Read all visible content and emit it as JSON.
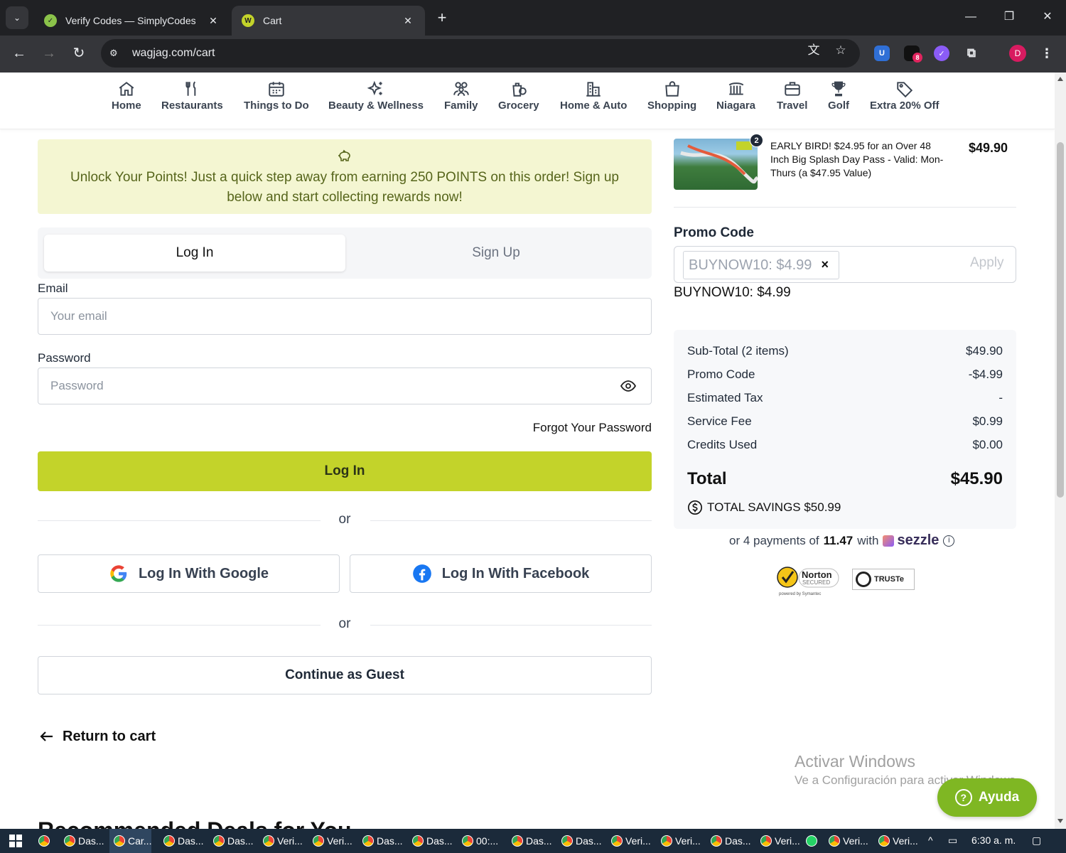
{
  "browser": {
    "tabs": [
      {
        "title": "Verify Codes — SimplyCodes",
        "active": false
      },
      {
        "title": "Cart",
        "active": true
      }
    ],
    "url": "wagjag.com/cart",
    "profile_initial": "D",
    "extension_badge": "8"
  },
  "categories": [
    {
      "label": "Home",
      "icon": "home-icon"
    },
    {
      "label": "Restaurants",
      "icon": "fork-knife-icon"
    },
    {
      "label": "Things to Do",
      "icon": "calendar-icon"
    },
    {
      "label": "Beauty & Wellness",
      "icon": "sparkles-icon"
    },
    {
      "label": "Family",
      "icon": "people-icon"
    },
    {
      "label": "Grocery",
      "icon": "grocery-bag-icon"
    },
    {
      "label": "Home & Auto",
      "icon": "building-icon"
    },
    {
      "label": "Shopping",
      "icon": "shopping-bag-icon"
    },
    {
      "label": "Niagara",
      "icon": "waterfall-icon"
    },
    {
      "label": "Travel",
      "icon": "suitcase-icon"
    },
    {
      "label": "Golf",
      "icon": "trophy-icon"
    },
    {
      "label": "Extra 20% Off",
      "icon": "tag-icon"
    }
  ],
  "banner": {
    "text": "Unlock Your Points! Just a quick step away from earning 250 POINTS on this order! Sign up below and start collecting rewards now!",
    "icon": "piggy-bank-icon"
  },
  "auth": {
    "tabs": {
      "login": "Log In",
      "signup": "Sign Up"
    },
    "email_label": "Email",
    "email_placeholder": "Your email",
    "password_label": "Password",
    "password_placeholder": "Password",
    "forgot": "Forgot Your Password",
    "login_button": "Log In",
    "or": "or",
    "google": "Log In With Google",
    "facebook": "Log In With Facebook",
    "guest": "Continue as Guest",
    "return": "Return to cart",
    "next_heading": "Recommended Deals for You"
  },
  "product": {
    "qty": "2",
    "title": "EARLY BIRD! $24.95 for an Over 48 Inch Big Splash Day Pass - Valid: Mon-Thurs (a $47.95 Value)",
    "price": "$49.90"
  },
  "promo": {
    "heading": "Promo Code",
    "chip": "BUYNOW10: $4.99",
    "apply": "Apply",
    "applied": "BUYNOW10: $4.99"
  },
  "summary": {
    "rows": [
      {
        "label": "Sub-Total (2 items)",
        "value": "$49.90"
      },
      {
        "label": "Promo Code",
        "value": "-$4.99"
      },
      {
        "label": "Estimated Tax",
        "value": "-"
      },
      {
        "label": "Service Fee",
        "value": "$0.99"
      },
      {
        "label": "Credits Used",
        "value": "$0.00"
      }
    ],
    "total_label": "Total",
    "total_value": "$45.90",
    "savings": "TOTAL SAVINGS $50.99"
  },
  "sezzle": {
    "prefix": "or 4 payments of",
    "amount": "11.47",
    "with": "with",
    "brand": "sezzle"
  },
  "trust": {
    "norton": "Norton",
    "norton_sub": "SECURED",
    "norton_pow": "powered by Symantec",
    "truste": "TRUSTe"
  },
  "watermark": {
    "line1": "Activar Windows",
    "line2": "Ve a Configuración para activar Windows."
  },
  "help": {
    "label": "Ayuda"
  },
  "taskbar": {
    "items": [
      "Das...",
      "Car...",
      "Das...",
      "Das...",
      "Veri...",
      "Veri...",
      "Das...",
      "Das...",
      "00:...",
      "Das...",
      "Das...",
      "Veri...",
      "Veri...",
      "Das...",
      "Veri...",
      "Veri...",
      "Veri..."
    ],
    "clock": "6:30 a. m."
  }
}
